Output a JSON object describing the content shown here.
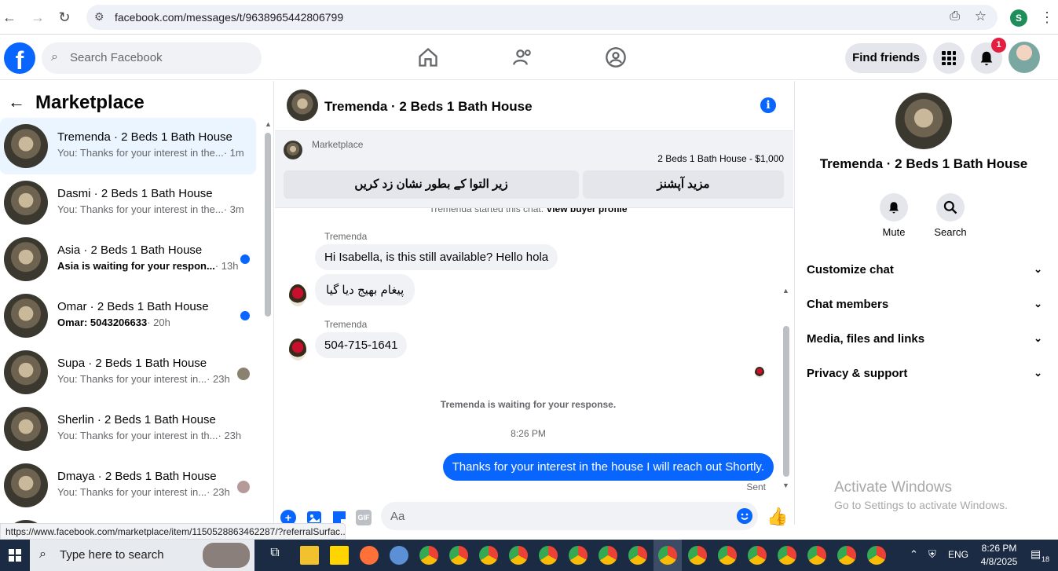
{
  "browser": {
    "url": "facebook.com/messages/t/9638965442806799",
    "profile_initial": "S"
  },
  "fbnav": {
    "logo": "f",
    "search_placeholder": "Search Facebook",
    "find_friends": "Find friends",
    "notification_count": "1"
  },
  "left": {
    "title": "Marketplace",
    "conversations": [
      {
        "name": "Tremenda · 2 Beds 1 Bath House",
        "preview": "You: Thanks for your interest in the...",
        "time": "· 1m",
        "active": true,
        "unread": false
      },
      {
        "name": "Dasmi · 2 Beds 1 Bath House",
        "preview": "You: Thanks for your interest in the...",
        "time": "· 3m",
        "active": false,
        "unread": false
      },
      {
        "name": "Asia · 2 Beds 1 Bath House",
        "preview": "Asia is waiting for your respon...",
        "time": "· 13h",
        "active": false,
        "unread": true
      },
      {
        "name": "Omar · 2 Beds 1 Bath House",
        "preview": "Omar: 5043206633",
        "time": "· 20h",
        "active": false,
        "unread": true
      },
      {
        "name": "Supa · 2 Beds 1 Bath House",
        "preview": "You: Thanks for your interest in...",
        "time": "· 23h",
        "active": false,
        "unread": false
      },
      {
        "name": "Sherlin · 2 Beds 1 Bath House",
        "preview": "You: Thanks for your interest in th...",
        "time": "· 23h",
        "active": false,
        "unread": false
      },
      {
        "name": "Dmaya · 2 Beds 1 Bath House",
        "preview": "You: Thanks for your interest in...",
        "time": "· 23h",
        "active": false,
        "unread": false
      }
    ]
  },
  "chat": {
    "title": "Tremenda · 2 Beds 1 Bath House",
    "banner_label": "Marketplace",
    "listing": "2 Beds 1 Bath House - $1,000",
    "mark_button": "زیر التوا کے بطور نشان زد کریں",
    "more_button": "مزید آپشنز",
    "started_text": "Tremenda started this chat.",
    "view_profile": "View buyer profile",
    "sender1": "Tremenda",
    "msg1": "Hi Isabella, is this still available?  Hello hola",
    "msg2": "پیغام بھیج دیا گیا",
    "sender2": "Tremenda",
    "msg3": "504-715-1641",
    "waiting": "Tremenda is waiting for your response.",
    "time": "8:26 PM",
    "out_msg": "Thanks for your interest in the house I will reach out Shortly.",
    "sent": "Sent",
    "input_placeholder": "Aa",
    "gif": "GIF"
  },
  "right": {
    "name": "Tremenda · 2 Beds 1 Bath House",
    "mute": "Mute",
    "search": "Search",
    "rows": [
      "Customize chat",
      "Chat members",
      "Media, files and links",
      "Privacy & support"
    ],
    "activate_title": "Activate Windows",
    "activate_sub": "Go to Settings to activate Windows."
  },
  "status_url": "https://www.facebook.com/marketplace/item/1150528863462287/?referralSurfac...",
  "taskbar": {
    "search_placeholder": "Type here to search",
    "lang": "ENG",
    "time": "8:26 PM",
    "date": "4/8/2025",
    "notif": "18"
  }
}
